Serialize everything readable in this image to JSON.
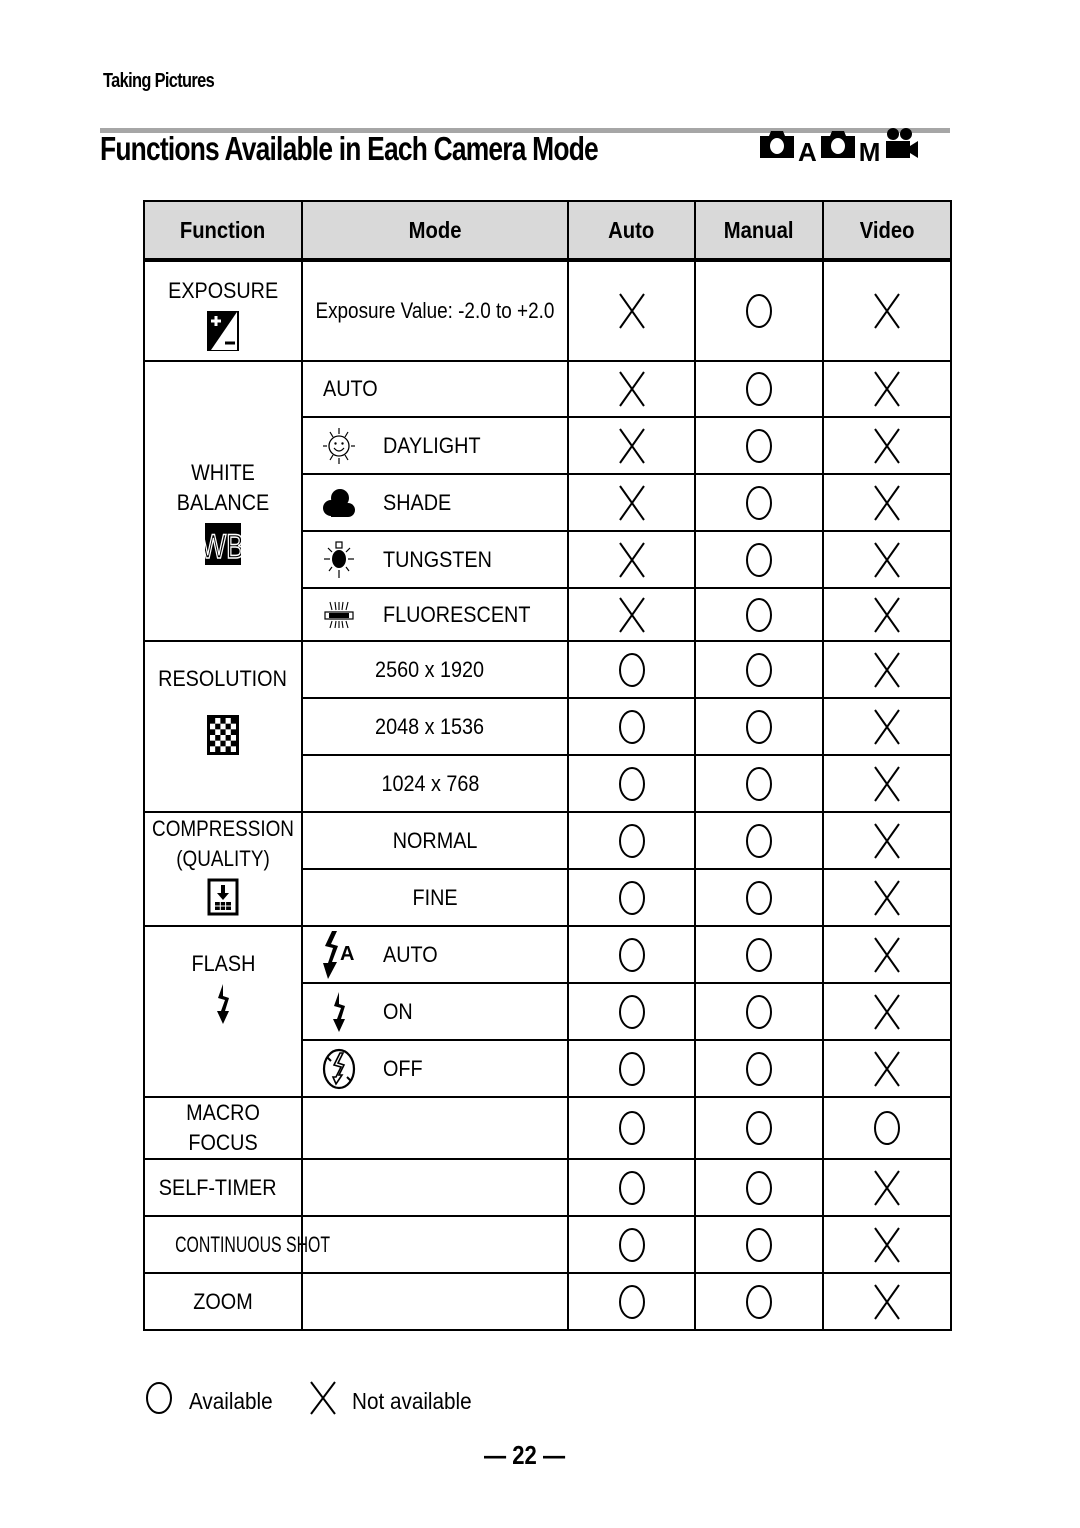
{
  "header": {
    "section": "Taking Pictures",
    "title": "Functions Available in Each Camera Mode",
    "mode_icons": [
      {
        "icon": "camera-auto-icon",
        "letter": "A"
      },
      {
        "icon": "camera-manual-icon",
        "letter": "M"
      },
      {
        "icon": "video-camera-icon",
        "letter": ""
      }
    ]
  },
  "table": {
    "columns": [
      "Function",
      "Mode",
      "Auto",
      "Manual",
      "Video"
    ],
    "groups": [
      {
        "function": "EXPOSURE",
        "icon": "exposure-compensation-icon",
        "rows": [
          {
            "mode": "Exposure Value: -2.0 to +2.0",
            "mode_icon": "",
            "auto": "X",
            "manual": "O",
            "video": "X"
          }
        ]
      },
      {
        "function": "WHITE BALANCE",
        "icon": "white-balance-icon",
        "rows": [
          {
            "mode": "AUTO",
            "mode_icon": "",
            "auto": "X",
            "manual": "O",
            "video": "X"
          },
          {
            "mode": "DAYLIGHT",
            "mode_icon": "sun-icon",
            "auto": "X",
            "manual": "O",
            "video": "X"
          },
          {
            "mode": "SHADE",
            "mode_icon": "cloud-icon",
            "auto": "X",
            "manual": "O",
            "video": "X"
          },
          {
            "mode": "TUNGSTEN",
            "mode_icon": "light-bulb-icon",
            "auto": "X",
            "manual": "O",
            "video": "X"
          },
          {
            "mode": "FLUORESCENT",
            "mode_icon": "fluorescent-lamp-icon",
            "auto": "X",
            "manual": "O",
            "video": "X"
          }
        ]
      },
      {
        "function": "RESOLUTION",
        "icon": "resolution-icon",
        "rows": [
          {
            "mode": "2560 x 1920",
            "mode_icon": "",
            "auto": "O",
            "manual": "O",
            "video": "X"
          },
          {
            "mode": "2048 x 1536",
            "mode_icon": "",
            "auto": "O",
            "manual": "O",
            "video": "X"
          },
          {
            "mode": "1024 x 768",
            "mode_icon": "",
            "auto": "O",
            "manual": "O",
            "video": "X"
          }
        ]
      },
      {
        "function": "COMPRESSION (QUALITY)",
        "icon": "quality-icon",
        "rows": [
          {
            "mode": "NORMAL",
            "mode_icon": "",
            "auto": "O",
            "manual": "O",
            "video": "X"
          },
          {
            "mode": "FINE",
            "mode_icon": "",
            "auto": "O",
            "manual": "O",
            "video": "X"
          }
        ]
      },
      {
        "function": "FLASH",
        "icon": "flash-icon",
        "rows": [
          {
            "mode": "AUTO",
            "mode_icon": "flash-auto-icon",
            "auto": "O",
            "manual": "O",
            "video": "X"
          },
          {
            "mode": "ON",
            "mode_icon": "flash-on-icon",
            "auto": "O",
            "manual": "O",
            "video": "X"
          },
          {
            "mode": "OFF",
            "mode_icon": "flash-off-icon",
            "auto": "O",
            "manual": "O",
            "video": "X"
          }
        ]
      },
      {
        "function": "MACRO FOCUS",
        "icon": "",
        "rows": [
          {
            "mode": "",
            "mode_icon": "",
            "auto": "O",
            "manual": "O",
            "video": "O"
          }
        ]
      },
      {
        "function": "SELF-TIMER",
        "icon": "",
        "rows": [
          {
            "mode": "",
            "mode_icon": "",
            "auto": "O",
            "manual": "O",
            "video": "X"
          }
        ]
      },
      {
        "function": "CONTINUOUS SHOT",
        "icon": "",
        "rows": [
          {
            "mode": "",
            "mode_icon": "",
            "auto": "O",
            "manual": "O",
            "video": "X"
          }
        ]
      },
      {
        "function": "ZOOM",
        "icon": "",
        "rows": [
          {
            "mode": "",
            "mode_icon": "",
            "auto": "O",
            "manual": "O",
            "video": "X"
          }
        ]
      }
    ]
  },
  "legend": {
    "available": "Available",
    "not_available": "Not available"
  },
  "footer": {
    "page_number": "— 22 —"
  }
}
